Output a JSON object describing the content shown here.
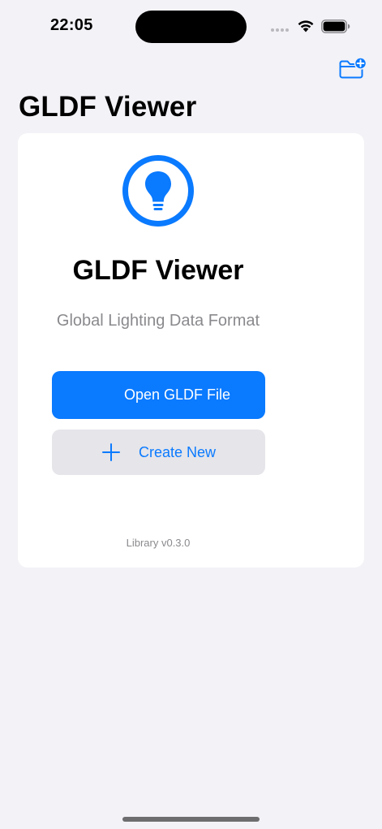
{
  "status_bar": {
    "time": "22:05"
  },
  "nav": {
    "large_title": "GLDF Viewer",
    "folder_button_icon": "folder-badge-plus-icon"
  },
  "welcome_card": {
    "logo_icon": "lightbulb-circle-icon",
    "title": "GLDF Viewer",
    "subtitle": "Global Lighting Data Format",
    "open_button_label": "Open GLDF File",
    "create_button_label": "Create New",
    "create_button_icon": "plus-icon",
    "version_text": "Library v0.3.0"
  },
  "colors": {
    "accent": "#0a7aff",
    "background": "#f2f2f7",
    "card": "#ffffff",
    "secondary_button": "#e5e5ea",
    "secondary_text": "#8a8a8e"
  }
}
